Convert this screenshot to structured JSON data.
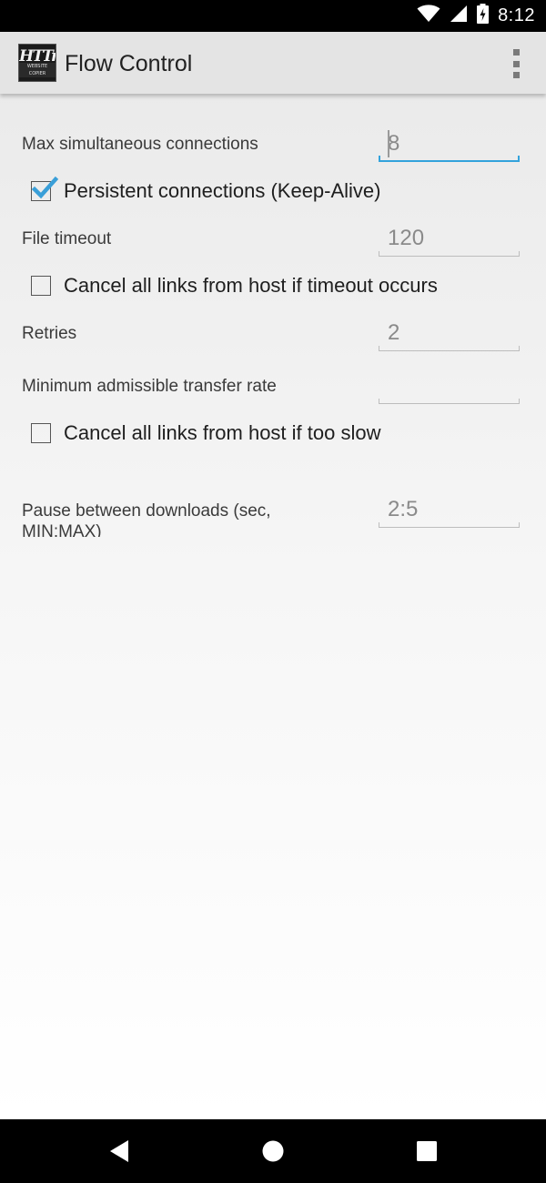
{
  "status_bar": {
    "time": "8:12",
    "icons": [
      "wifi-icon",
      "cellular-signal-icon",
      "battery-charging-icon"
    ]
  },
  "action_bar": {
    "title": "Flow Control",
    "logo_text_top": "HTTrack",
    "logo_text_bottom": "WEBSITE COPIER",
    "overflow_icon": "more-vert-icon"
  },
  "form": {
    "max_connections": {
      "label": "Max simultaneous connections",
      "value": "8"
    },
    "persistent": {
      "label": "Persistent connections (Keep-Alive)",
      "checked": true
    },
    "file_timeout": {
      "label": "File timeout",
      "value": "120"
    },
    "cancel_timeout": {
      "label": "Cancel all links from host if timeout occurs",
      "checked": false
    },
    "retries": {
      "label": "Retries",
      "value": "2"
    },
    "min_rate": {
      "label": "Minimum admissible transfer rate",
      "value": ""
    },
    "cancel_slow": {
      "label": "Cancel all links from host if too slow",
      "checked": false
    },
    "pause": {
      "label": "Pause between downloads (sec, MIN:MAX)",
      "value": "2:5"
    }
  },
  "nav_bar": {
    "icons": [
      "back-icon",
      "home-icon",
      "recents-icon"
    ]
  },
  "colors": {
    "accent": "#33a3dc",
    "action_bar": "#e4e4e4",
    "text": "#212121"
  }
}
